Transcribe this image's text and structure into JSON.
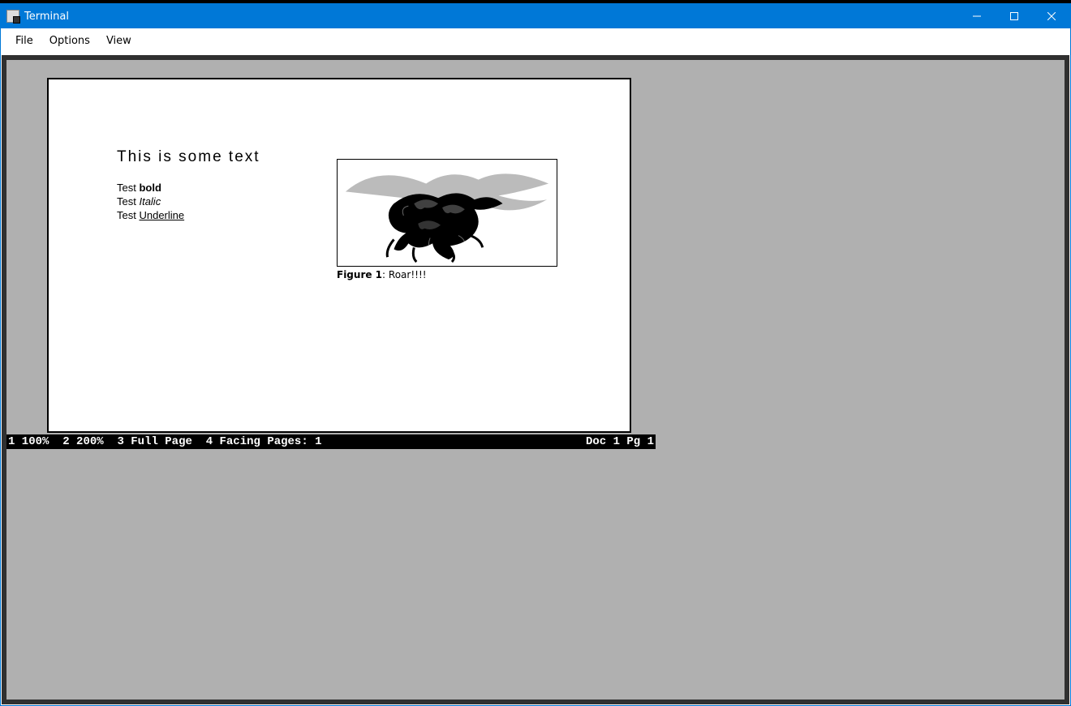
{
  "window": {
    "title": "Terminal"
  },
  "menu": {
    "file": "File",
    "options": "Options",
    "view": "View"
  },
  "doc": {
    "heading": "This is some text",
    "test_prefix": "Test ",
    "bold_word": "bold",
    "italic_word": "Italic",
    "underline_word": "Underline",
    "figure_label": "Figure 1",
    "figure_caption_rest": ": Roar!!!!"
  },
  "status": {
    "opt1": "1 100%",
    "opt2": "2 200%",
    "opt3": "3 Full Page",
    "opt4": "4 Facing Pages: 1",
    "right": "Doc 1 Pg 1"
  }
}
